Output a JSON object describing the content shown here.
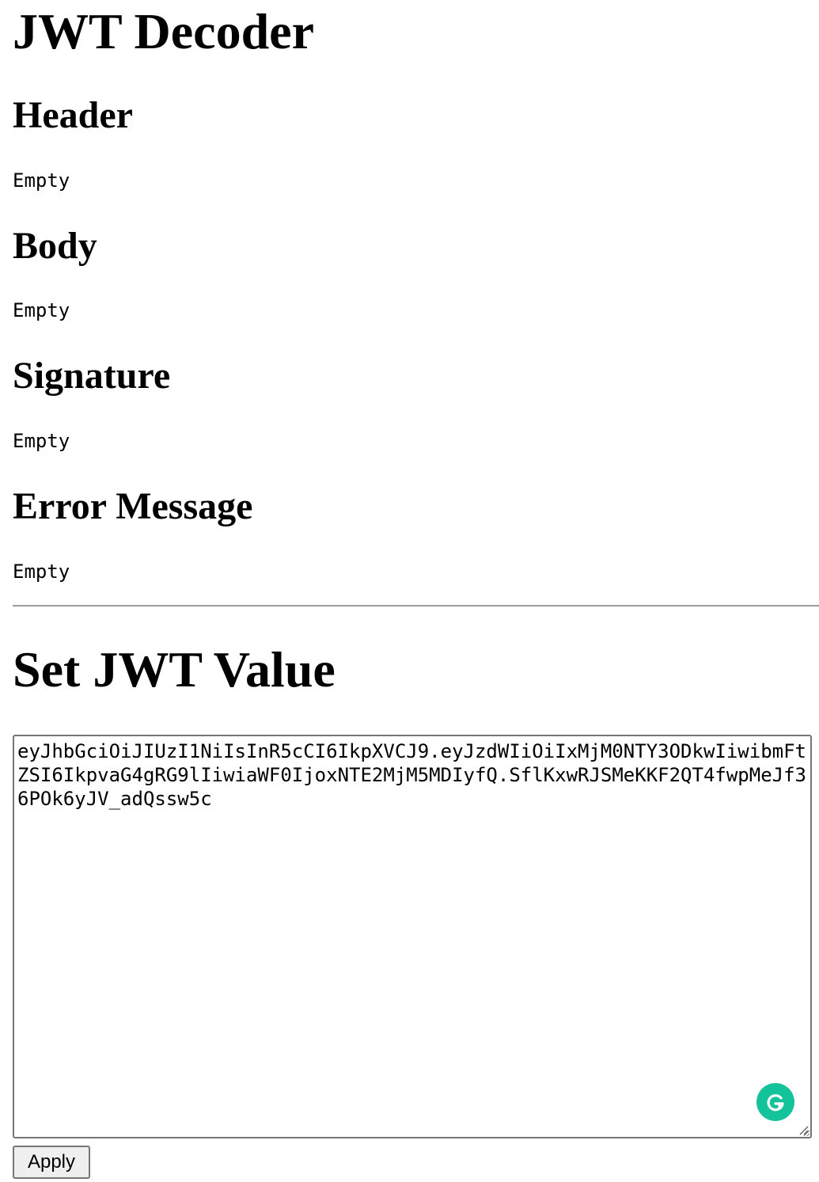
{
  "page": {
    "title": "JWT Decoder"
  },
  "sections": {
    "header": {
      "heading": "Header",
      "value": "Empty"
    },
    "body": {
      "heading": "Body",
      "value": "Empty"
    },
    "signature": {
      "heading": "Signature",
      "value": "Empty"
    },
    "error": {
      "heading": "Error Message",
      "value": "Empty"
    }
  },
  "form": {
    "heading": "Set JWT Value",
    "jwt_value": "eyJhbGciOiJIUzI1NiIsInR5cCI6IkpXVCJ9.eyJzdWIiOiIxMjM0NTY3ODkwIiwibmFtZSI6IkpvaG4gRG9lIiwiaWF0IjoxNTE2MjM5MDIyfQ.SflKxwRJSMeKKF2QT4fwpMeJf36POk6yJV_adQssw5c",
    "apply_label": "Apply"
  },
  "icons": {
    "grammar_badge": "grammarly-icon",
    "resize": "resize-handle-icon"
  },
  "colors": {
    "badge": "#15c39a"
  }
}
